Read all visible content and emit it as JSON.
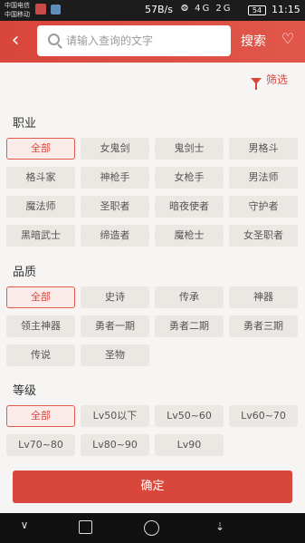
{
  "status_bar": {
    "carrier_1": "中国电信",
    "carrier_2": "中国移动",
    "speed": "57B/s",
    "signal_icons": "⨷ 4G 2G",
    "battery": "54",
    "time": "11:15"
  },
  "header": {
    "back_icon": "chevron-left-icon",
    "search_placeholder": "请输入查询的文字",
    "search_label": "搜索",
    "favorite_icon": "heart-icon"
  },
  "filter": {
    "label": "筛选"
  },
  "sections": {
    "profession": {
      "title": "职业",
      "options": [
        "全部",
        "女鬼剑",
        "鬼剑士",
        "男格斗",
        "格斗家",
        "神枪手",
        "女枪手",
        "男法师",
        "魔法师",
        "圣职者",
        "暗夜使者",
        "守护者",
        "黑暗武士",
        "缔造者",
        "魔枪士",
        "女圣职者"
      ],
      "selected": "全部"
    },
    "quality": {
      "title": "品质",
      "options": [
        "全部",
        "史诗",
        "传承",
        "神器",
        "领主神器",
        "勇者一期",
        "勇者二期",
        "勇者三期",
        "传说",
        "圣物"
      ],
      "selected": "全部"
    },
    "level": {
      "title": "等级",
      "options": [
        "全部",
        "Lv50以下",
        "Lv50~60",
        "Lv60~70",
        "Lv70~80",
        "Lv80~90",
        "Lv90"
      ],
      "selected": "全部"
    }
  },
  "confirm_label": "确定",
  "navbar": {
    "back_glyph": "∨"
  }
}
